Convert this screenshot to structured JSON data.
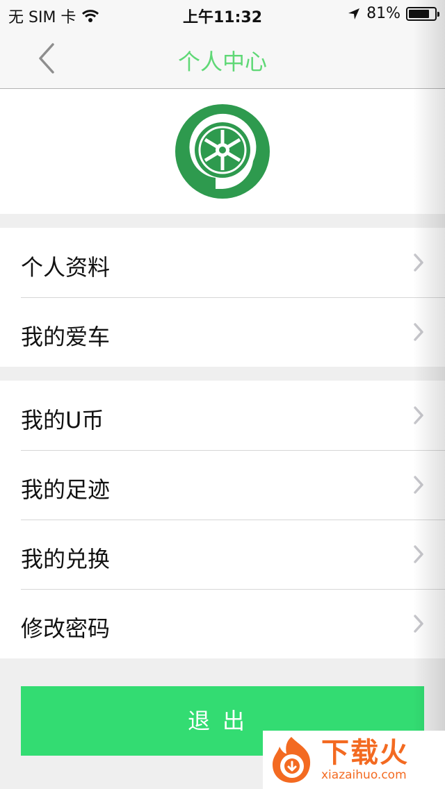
{
  "status_bar": {
    "carrier": "无 SIM 卡",
    "time": "上午11:32",
    "battery_percent": "81%",
    "battery_level": 0.81,
    "icons": [
      "wifi-icon",
      "location-arrow-icon",
      "battery-icon"
    ]
  },
  "nav": {
    "title": "个人中心",
    "back_icon": "chevron-left-icon"
  },
  "logo_icon": "wheel-logo-icon",
  "menu_groups": [
    [
      {
        "label": "个人资料"
      },
      {
        "label": "我的爱车"
      }
    ],
    [
      {
        "label": "我的U币"
      },
      {
        "label": "我的足迹"
      },
      {
        "label": "我的兑换"
      },
      {
        "label": "修改密码"
      }
    ]
  ],
  "logout_label": "退出",
  "watermark": {
    "title": "下载火",
    "url": "xiazaihuo.com"
  },
  "colors": {
    "accent_title": "#5fd876",
    "logout_button": "#33dc72",
    "logo_green": "#2e9a4e",
    "watermark_orange": "#f36a21"
  }
}
